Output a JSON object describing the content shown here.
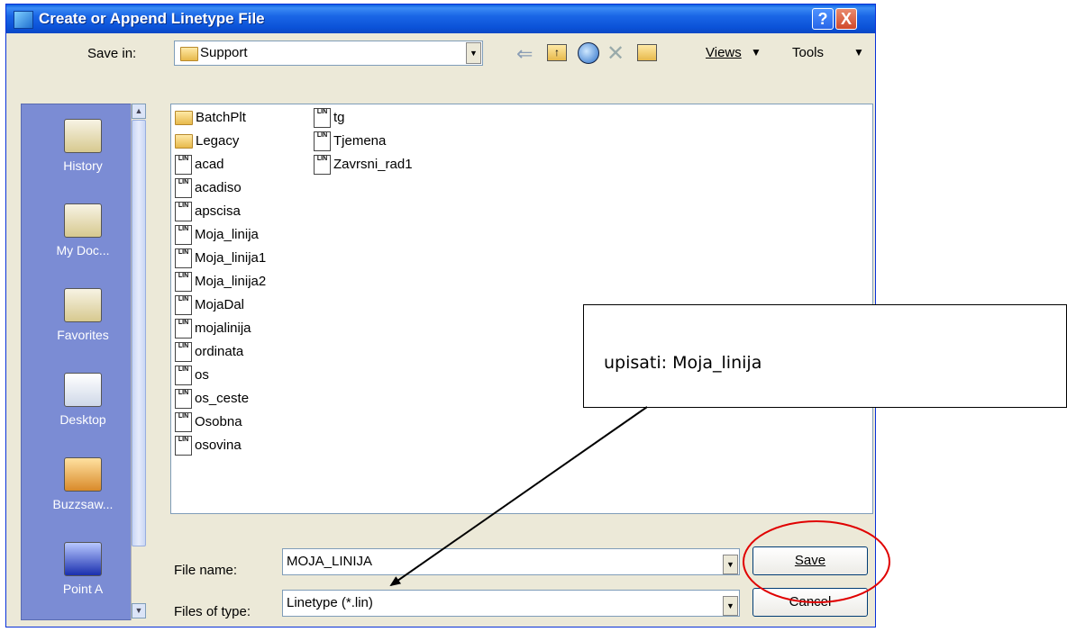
{
  "window": {
    "title": "Create or Append Linetype File",
    "help": "?",
    "close": "X"
  },
  "save_in": {
    "label": "Save in:",
    "value": "Support"
  },
  "toolbar": {
    "views": "Views",
    "tools": "Tools"
  },
  "places": [
    {
      "label": "History",
      "icon": "history-icon"
    },
    {
      "label": "My Doc...",
      "icon": "my-documents-icon"
    },
    {
      "label": "Favorites",
      "icon": "favorites-icon"
    },
    {
      "label": "Desktop",
      "icon": "desktop-icon"
    },
    {
      "label": "Buzzsaw...",
      "icon": "buzzsaw-icon"
    },
    {
      "label": "Point A",
      "icon": "point-a-icon"
    }
  ],
  "files_col1": [
    "BatchPlt",
    "Legacy",
    "acad",
    "acadiso",
    "apscisa",
    "Moja_linija",
    "Moja_linija1",
    "Moja_linija2",
    "MojaDal",
    "mojalinija",
    "ordinata",
    "os",
    "os_ceste",
    "Osobna",
    "osovina"
  ],
  "files_col2": [
    "tg",
    "Tjemena",
    "Zavrsni_rad1"
  ],
  "file_name": {
    "label": "File name:",
    "value": "MOJA_LINIJA"
  },
  "file_type": {
    "label": "Files of type:",
    "value": "Linetype (*.lin)"
  },
  "buttons": {
    "save": "Save",
    "cancel": "Cancel"
  },
  "callout": {
    "text": "upisati: Moja_linija"
  },
  "colors": {
    "title_bar": "#0b52d8",
    "places_bar": "#7b8cd4",
    "annotation_circle": "#e00000"
  }
}
